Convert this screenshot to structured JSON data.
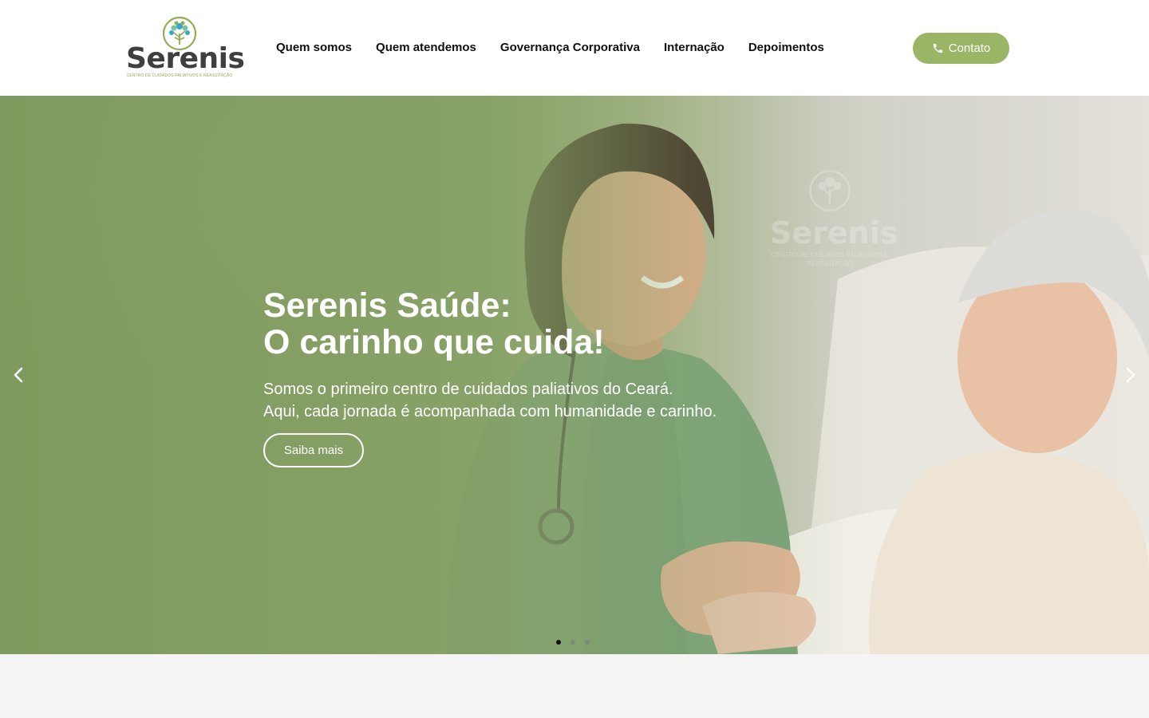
{
  "brand": {
    "name": "Serenis",
    "tagline": "CENTRO DE CUIDADOS PALIATIVOS E REASSITAÇÃO",
    "logo_icon": "tree-icon",
    "accent_color": "#9bb567",
    "logo_green": "#8fae57",
    "logo_blue": "#3aa7c9"
  },
  "nav": {
    "items": [
      {
        "label": "Quem somos"
      },
      {
        "label": "Quem atendemos"
      },
      {
        "label": "Governança Corporativa"
      },
      {
        "label": "Internação"
      },
      {
        "label": "Depoimentos"
      }
    ]
  },
  "contact_button": {
    "label": "Contato",
    "icon": "phone-icon"
  },
  "hero": {
    "title_line1": "Serenis Saúde:",
    "title_line2": "O carinho que cuida!",
    "subtitle_line1": "Somos o primeiro centro de cuidados paliativos do Ceará.",
    "subtitle_line2": "Aqui, cada jornada é acompanhada com humanidade e carinho.",
    "cta_label": "Saiba mais",
    "watermark_name": "Serenis",
    "watermark_tagline": "CENTRO DE CUIDADOS PALIATIVOS E REABILITAÇÃO"
  },
  "carousel": {
    "prev_icon": "chevron-left-icon",
    "next_icon": "chevron-right-icon",
    "slide_count": 3,
    "active_slide": 1
  }
}
